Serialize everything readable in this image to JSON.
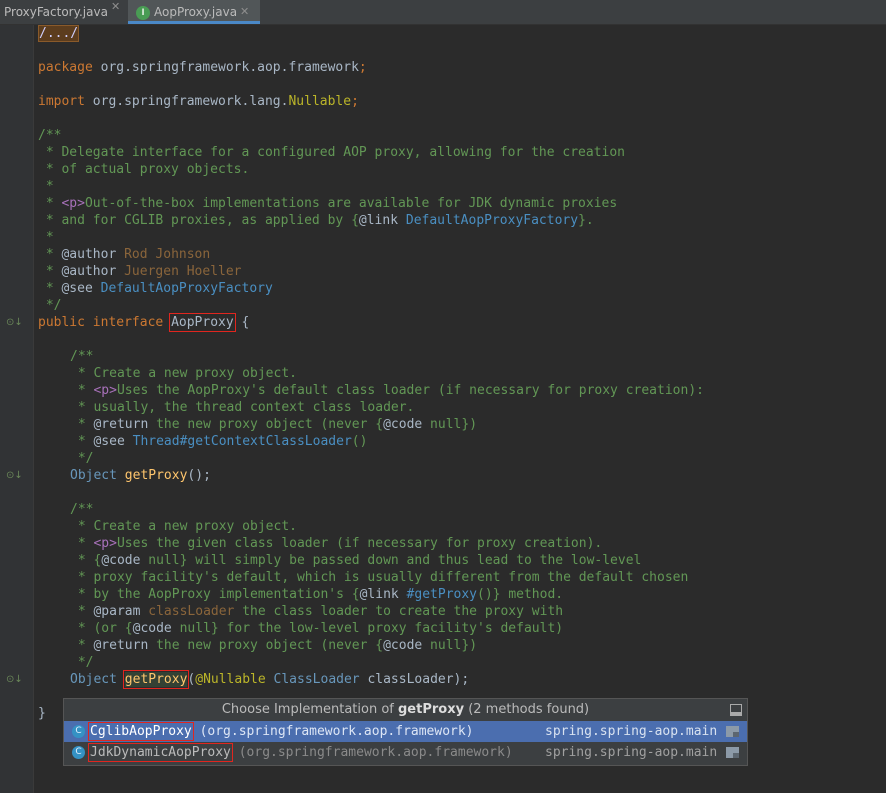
{
  "tabs": [
    {
      "label": "ProxyFactory.java",
      "active": false
    },
    {
      "label": "AopProxy.java",
      "active": true,
      "badge": "I"
    }
  ],
  "code": {
    "fold": "/.../",
    "package_kw": "package",
    "package_name": "org.springframework.aop.framework",
    "semicolon": ";",
    "import_kw": "import",
    "import_name": "org.springframework.lang.",
    "import_ann": "Nullable",
    "doc1_open": "/**",
    "doc1_l1": " * Delegate interface for a configured AOP proxy, allowing for the creation",
    "doc1_l2": " * of actual proxy objects.",
    "doc1_l3": " *",
    "doc1_l4_a": " * ",
    "doc1_l4_tag": "<p>",
    "doc1_l4_b": "Out-of-the-box implementations are available for JDK dynamic proxies",
    "doc1_l5_a": " * and for CGLIB proxies, as applied by {",
    "doc1_l5_at": "@link",
    "doc1_l5_link": " DefaultAopProxyFactory",
    "doc1_l5_b": "}.",
    "doc1_l6": " *",
    "doc1_l7_a": " * ",
    "doc1_l7_at": "@author",
    "doc1_l7_v": " Rod Johnson",
    "doc1_l8_a": " * ",
    "doc1_l8_at": "@author",
    "doc1_l8_v": " Juergen Hoeller",
    "doc1_l9_a": " * ",
    "doc1_l9_at": "@see",
    "doc1_l9_link": " DefaultAopProxyFactory",
    "doc1_close": " */",
    "iface_public": "public",
    "iface_interface": "interface",
    "iface_name": "AopProxy",
    "iface_brace": " {",
    "doc2_open": "/**",
    "doc2_l1": " * Create a new proxy object.",
    "doc2_l2_a": " * ",
    "doc2_l2_tag": "<p>",
    "doc2_l2_b": "Uses the AopProxy's default class loader (if necessary for proxy creation):",
    "doc2_l3": " * usually, the thread context class loader.",
    "doc2_l4_a": " * ",
    "doc2_l4_at": "@return",
    "doc2_l4_b": " the new proxy object (never {",
    "doc2_l4_at2": "@code",
    "doc2_l4_c": " null})",
    "doc2_l5_a": " * ",
    "doc2_l5_at": "@see",
    "doc2_l5_link": " Thread#getContextClassLoader",
    "doc2_l5_b": "()",
    "doc2_close": " */",
    "m1_type": "Object",
    "m1_name": "getProxy",
    "m1_rest": "();",
    "doc3_open": "/**",
    "doc3_l1": " * Create a new proxy object.",
    "doc3_l2_a": " * ",
    "doc3_l2_tag": "<p>",
    "doc3_l2_b": "Uses the given class loader (if necessary for proxy creation).",
    "doc3_l3_a": " * {",
    "doc3_l3_at": "@code",
    "doc3_l3_b": " null} will simply be passed down and thus lead to the low-level",
    "doc3_l4": " * proxy facility's default, which is usually different from the default chosen",
    "doc3_l5_a": " * by the AopProxy implementation's {",
    "doc3_l5_at": "@link",
    "doc3_l5_link": " #getProxy",
    "doc3_l5_b": "()} method.",
    "doc3_l6_a": " * ",
    "doc3_l6_at": "@param",
    "doc3_l6_v": " classLoader",
    "doc3_l6_b": " the class loader to create the proxy with",
    "doc3_l7_a": " * (or {",
    "doc3_l7_at": "@code",
    "doc3_l7_b": " null} for the low-level proxy facility's default)",
    "doc3_l8_a": " * ",
    "doc3_l8_at": "@return",
    "doc3_l8_b": " the new proxy object (never {",
    "doc3_l8_at2": "@code",
    "doc3_l8_c": " null})",
    "doc3_close": " */",
    "m2_type": "Object",
    "m2_name": "getProxy",
    "m2_paren": "(",
    "m2_ann": "@Nullable",
    "m2_ptype": " ClassLoader",
    "m2_rest": " classLoader);",
    "close_brace": "}"
  },
  "popup": {
    "title_prefix": "Choose Implementation of ",
    "title_method": "getProxy",
    "title_suffix": " (2 methods found)",
    "items": [
      {
        "icon": "C",
        "name": "CglibAopProxy",
        "package": " (org.springframework.aop.framework)",
        "module": "spring.spring-aop.main",
        "selected": true
      },
      {
        "icon": "C",
        "name": "JdkDynamicAopProxy",
        "package": " (org.springframework.aop.framework)",
        "module": "spring.spring-aop.main",
        "selected": false
      }
    ]
  }
}
